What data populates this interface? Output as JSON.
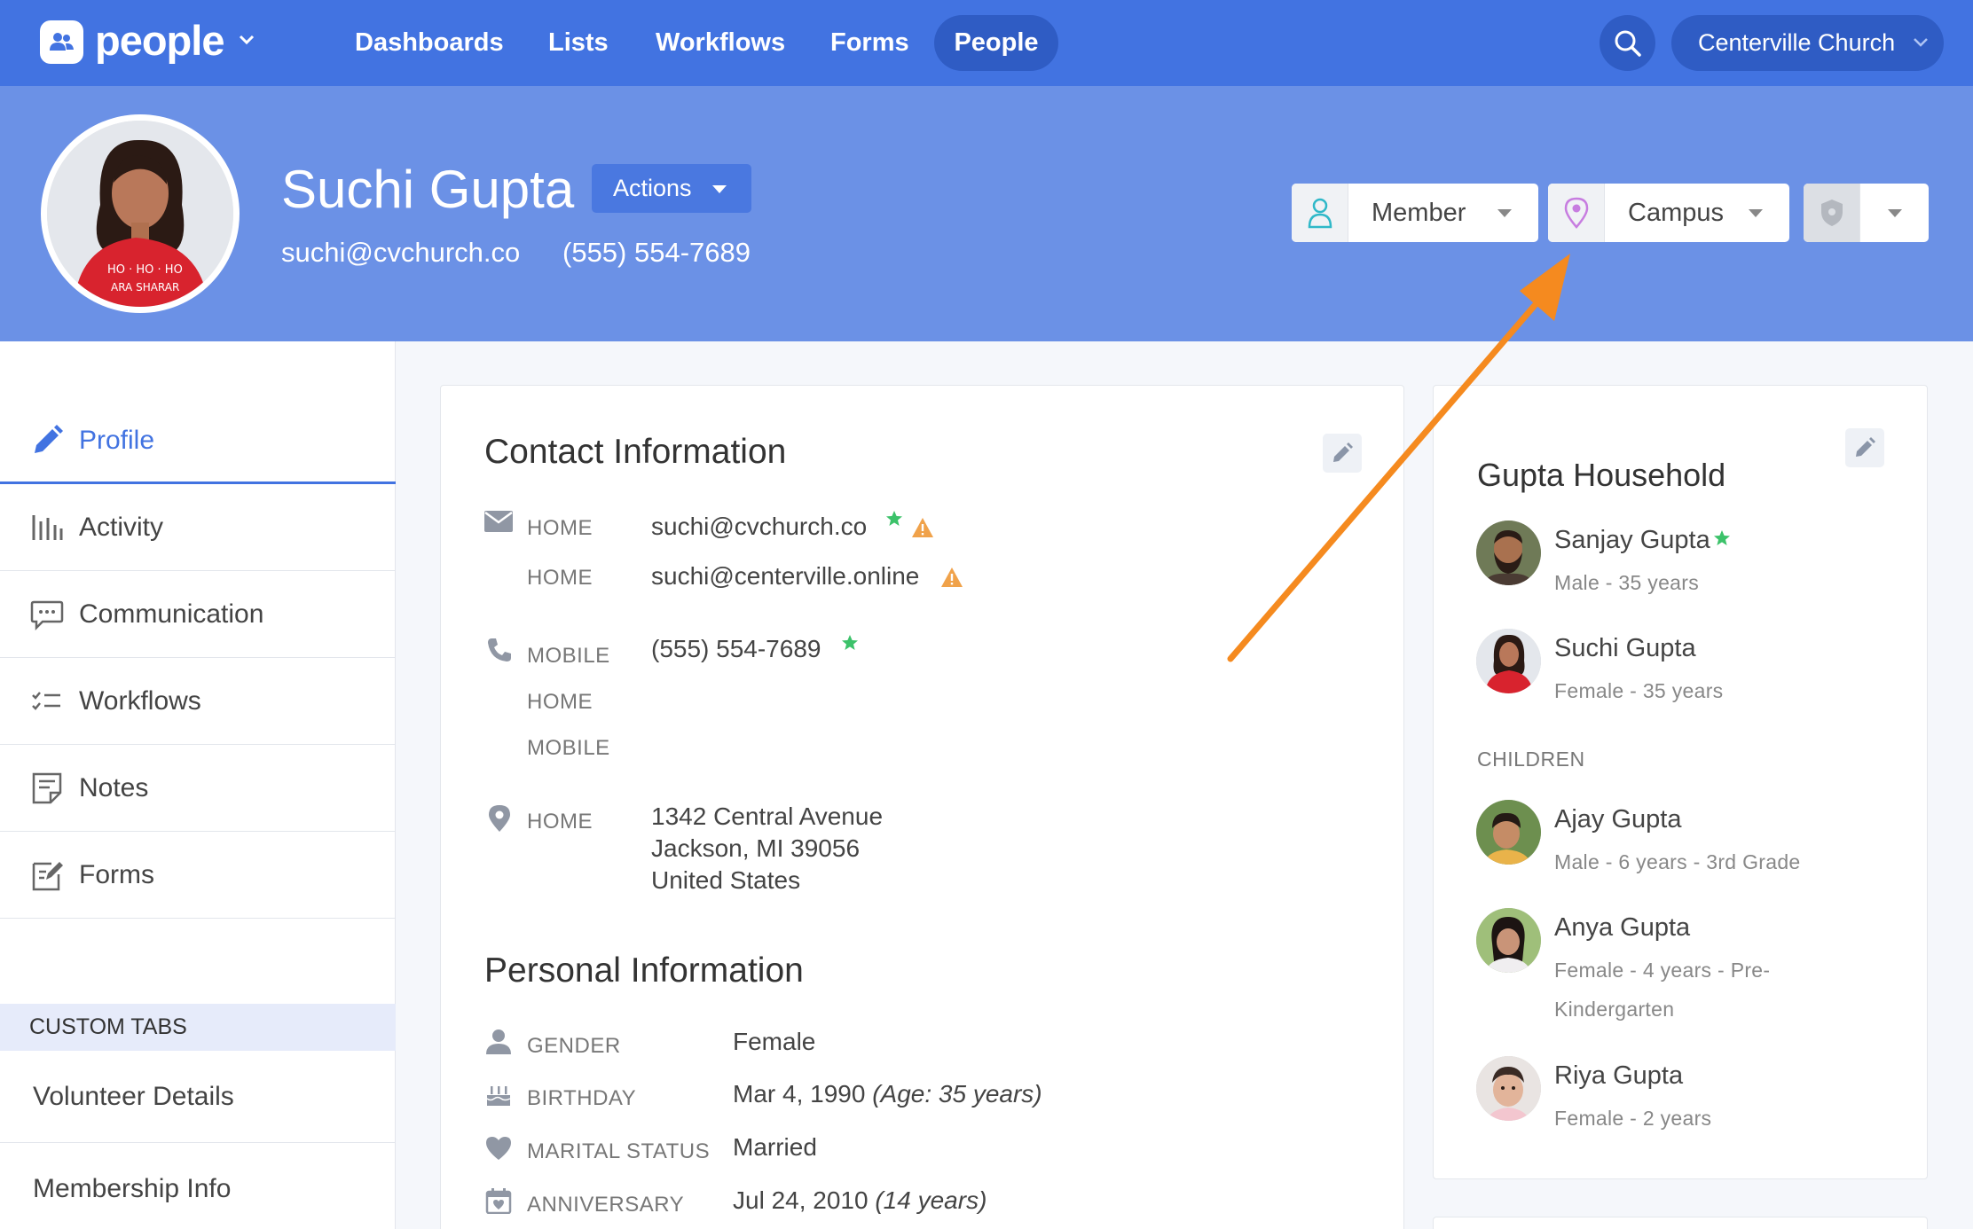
{
  "app": {
    "name": "people"
  },
  "nav": {
    "items": [
      "Dashboards",
      "Lists",
      "Workflows",
      "Forms"
    ],
    "active": "People",
    "org": "Centerville Church"
  },
  "profile": {
    "name": "Suchi Gupta",
    "actions_label": "Actions",
    "email": "suchi@cvchurch.co",
    "phone": "(555) 554-7689",
    "membership": "Member",
    "campus": "Campus"
  },
  "sidebar": {
    "items": [
      {
        "label": "Profile",
        "icon": "pencil-icon",
        "active": true
      },
      {
        "label": "Activity",
        "icon": "activity-icon"
      },
      {
        "label": "Communication",
        "icon": "chat-icon"
      },
      {
        "label": "Workflows",
        "icon": "checklist-icon"
      },
      {
        "label": "Notes",
        "icon": "note-icon"
      },
      {
        "label": "Forms",
        "icon": "form-icon"
      }
    ],
    "custom_tabs_label": "CUSTOM TABS",
    "custom_tabs": [
      "Volunteer Details",
      "Membership Info"
    ]
  },
  "contact": {
    "title": "Contact Information",
    "emails": [
      {
        "type": "HOME",
        "value": "suchi@cvchurch.co"
      },
      {
        "type": "HOME",
        "value": "suchi@centerville.online"
      }
    ],
    "phones": [
      {
        "type": "MOBILE",
        "value": "(555) 554-7689"
      },
      {
        "type": "HOME",
        "value": ""
      },
      {
        "type": "MOBILE",
        "value": ""
      }
    ],
    "address": {
      "type": "HOME",
      "line1": "1342 Central Avenue",
      "line2": "Jackson, MI 39056",
      "line3": "United States"
    }
  },
  "personal": {
    "title": "Personal Information",
    "gender_label": "GENDER",
    "gender": "Female",
    "birthday_label": "BIRTHDAY",
    "birthday": "Mar 4, 1990",
    "age": "(Age: 35 years)",
    "marital_label": "MARITAL STATUS",
    "marital": "Married",
    "anniversary_label": "ANNIVERSARY",
    "anniversary": "Jul 24, 2010",
    "anniversary_years": "(14 years)"
  },
  "household": {
    "title": "Gupta Household",
    "adults": [
      {
        "name": "Sanjay Gupta",
        "sub": "Male - 35 years"
      },
      {
        "name": "Suchi Gupta",
        "sub": "Female - 35 years"
      }
    ],
    "children_label": "CHILDREN",
    "children": [
      {
        "name": "Ajay Gupta",
        "sub": "Male - 6 years - 3rd Grade"
      },
      {
        "name": "Anya Gupta",
        "sub": "Female - 4 years - Pre-Kindergarten"
      },
      {
        "name": "Riya Gupta",
        "sub": "Female - 2 years"
      }
    ]
  },
  "colors": {
    "nav": "#4273e1",
    "header": "#6b91e6",
    "accent": "#4273e1",
    "star": "#3cc26a",
    "warning": "#f0a24a",
    "arrow": "#f58a1f"
  }
}
